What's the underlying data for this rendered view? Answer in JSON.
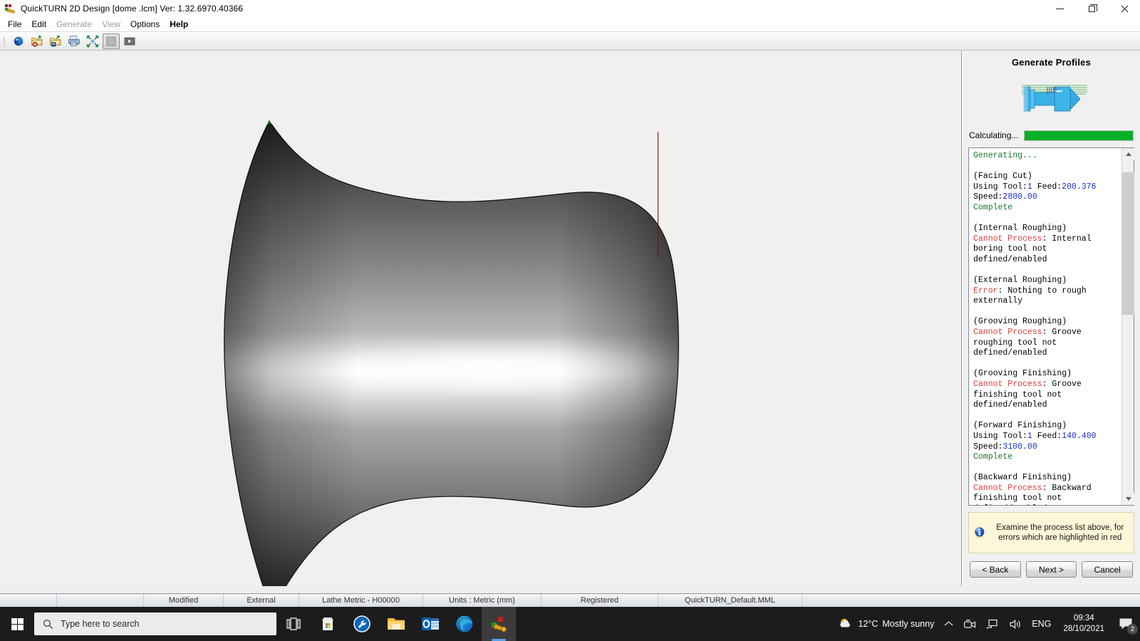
{
  "window": {
    "title": "QuickTURN 2D Design [dome .lcm] Ver: 1.32.6970.40366",
    "minimize_label": "Minimize",
    "maximize_label": "Restore",
    "close_label": "Close"
  },
  "menu": {
    "items": [
      {
        "label": "File",
        "state": "normal"
      },
      {
        "label": "Edit",
        "state": "normal"
      },
      {
        "label": "Generate",
        "state": "disabled"
      },
      {
        "label": "View",
        "state": "disabled"
      },
      {
        "label": "Options",
        "state": "normal"
      },
      {
        "label": "Help",
        "state": "bold"
      }
    ]
  },
  "toolbar": {
    "buttons": [
      {
        "name": "render-solid-icon",
        "tip": "Solid render"
      },
      {
        "name": "open-folder-delete-icon",
        "tip": "Open / remove profile"
      },
      {
        "name": "open-folder-save-icon",
        "tip": "Open / save profile"
      },
      {
        "name": "print-preview-icon",
        "tip": "Print"
      },
      {
        "name": "zoom-fit-icon",
        "tip": "Zoom to fit"
      },
      {
        "name": "shade-toggle-icon",
        "tip": "Shaded view",
        "pressed": true
      },
      {
        "name": "run-simulation-icon",
        "tip": "Run simulation"
      }
    ]
  },
  "viewport": {
    "part_name": "dome",
    "centerline_color": "#8b0000",
    "background_color": "#f0f0ee"
  },
  "wizard": {
    "title": "Generate Profiles",
    "hero_icon": "lathe-part-preview",
    "progress": {
      "label": "Calculating...",
      "percent": 100,
      "color": "#06b025"
    },
    "log": [
      {
        "text": "Generating...",
        "color": "green"
      },
      {
        "text": "",
        "color": "black"
      },
      {
        "text": "(Facing Cut)",
        "color": "black"
      },
      {
        "text": "Using Tool:1 Feed:200.376",
        "color": "mixed"
      },
      {
        "text": "Speed:2800.00",
        "color": "mixed"
      },
      {
        "text": "Complete",
        "color": "green"
      },
      {
        "text": "",
        "color": "black"
      },
      {
        "text": "(Internal Roughing)",
        "color": "black"
      },
      {
        "text": "Cannot Process: Internal boring tool not defined/enabled",
        "color": "error"
      },
      {
        "text": "",
        "color": "black"
      },
      {
        "text": "(External Roughing)",
        "color": "black"
      },
      {
        "text": "Error: Nothing to rough externally",
        "color": "error"
      },
      {
        "text": "",
        "color": "black"
      },
      {
        "text": "(Grooving Roughing)",
        "color": "black"
      },
      {
        "text": "Cannot Process: Groove roughing tool not defined/enabled",
        "color": "error"
      },
      {
        "text": "",
        "color": "black"
      },
      {
        "text": "(Grooving Finishing)",
        "color": "black"
      },
      {
        "text": "Cannot Process: Groove finishing tool not defined/enabled",
        "color": "error"
      },
      {
        "text": "",
        "color": "black"
      },
      {
        "text": "(Forward Finishing)",
        "color": "black"
      },
      {
        "text": "Using Tool:1 Feed:140.400",
        "color": "mixed"
      },
      {
        "text": "Speed:3100.00",
        "color": "mixed"
      },
      {
        "text": "Complete",
        "color": "green"
      },
      {
        "text": "",
        "color": "black"
      },
      {
        "text": "(Backward Finishing)",
        "color": "black"
      },
      {
        "text": "Cannot Process: Backward finishing tool not defined/enabled",
        "color": "error"
      }
    ],
    "hint": "Examine the process list above, for errors which are highlighted in red",
    "hint_icon": "info-icon",
    "buttons": {
      "back": "< Back",
      "next": "Next >",
      "cancel": "Cancel"
    }
  },
  "statusbar": {
    "cells": [
      "",
      "",
      "Modified",
      "External",
      "Lathe Metric - H00000",
      "Units : Metric (mm)",
      "Registered",
      "QuickTURN_Default.MML",
      ""
    ]
  },
  "taskbar": {
    "start_label": "Start",
    "search_placeholder": "Type here to search",
    "apps": [
      {
        "name": "task-view-icon",
        "label": "Task View"
      },
      {
        "name": "microsoft-store-icon",
        "label": "Microsoft Store"
      },
      {
        "name": "settings-tool-icon",
        "label": "Tools"
      },
      {
        "name": "file-explorer-icon",
        "label": "File Explorer"
      },
      {
        "name": "outlook-icon",
        "label": "Outlook"
      },
      {
        "name": "edge-icon",
        "label": "Microsoft Edge"
      },
      {
        "name": "quickturn-icon",
        "label": "QuickTURN 2D Design",
        "active": true
      }
    ],
    "weather": {
      "temperature": "12°C",
      "condition": "Mostly sunny"
    },
    "language": "ENG",
    "time": "09:34",
    "date": "28/10/2021",
    "notification_count": "2"
  }
}
